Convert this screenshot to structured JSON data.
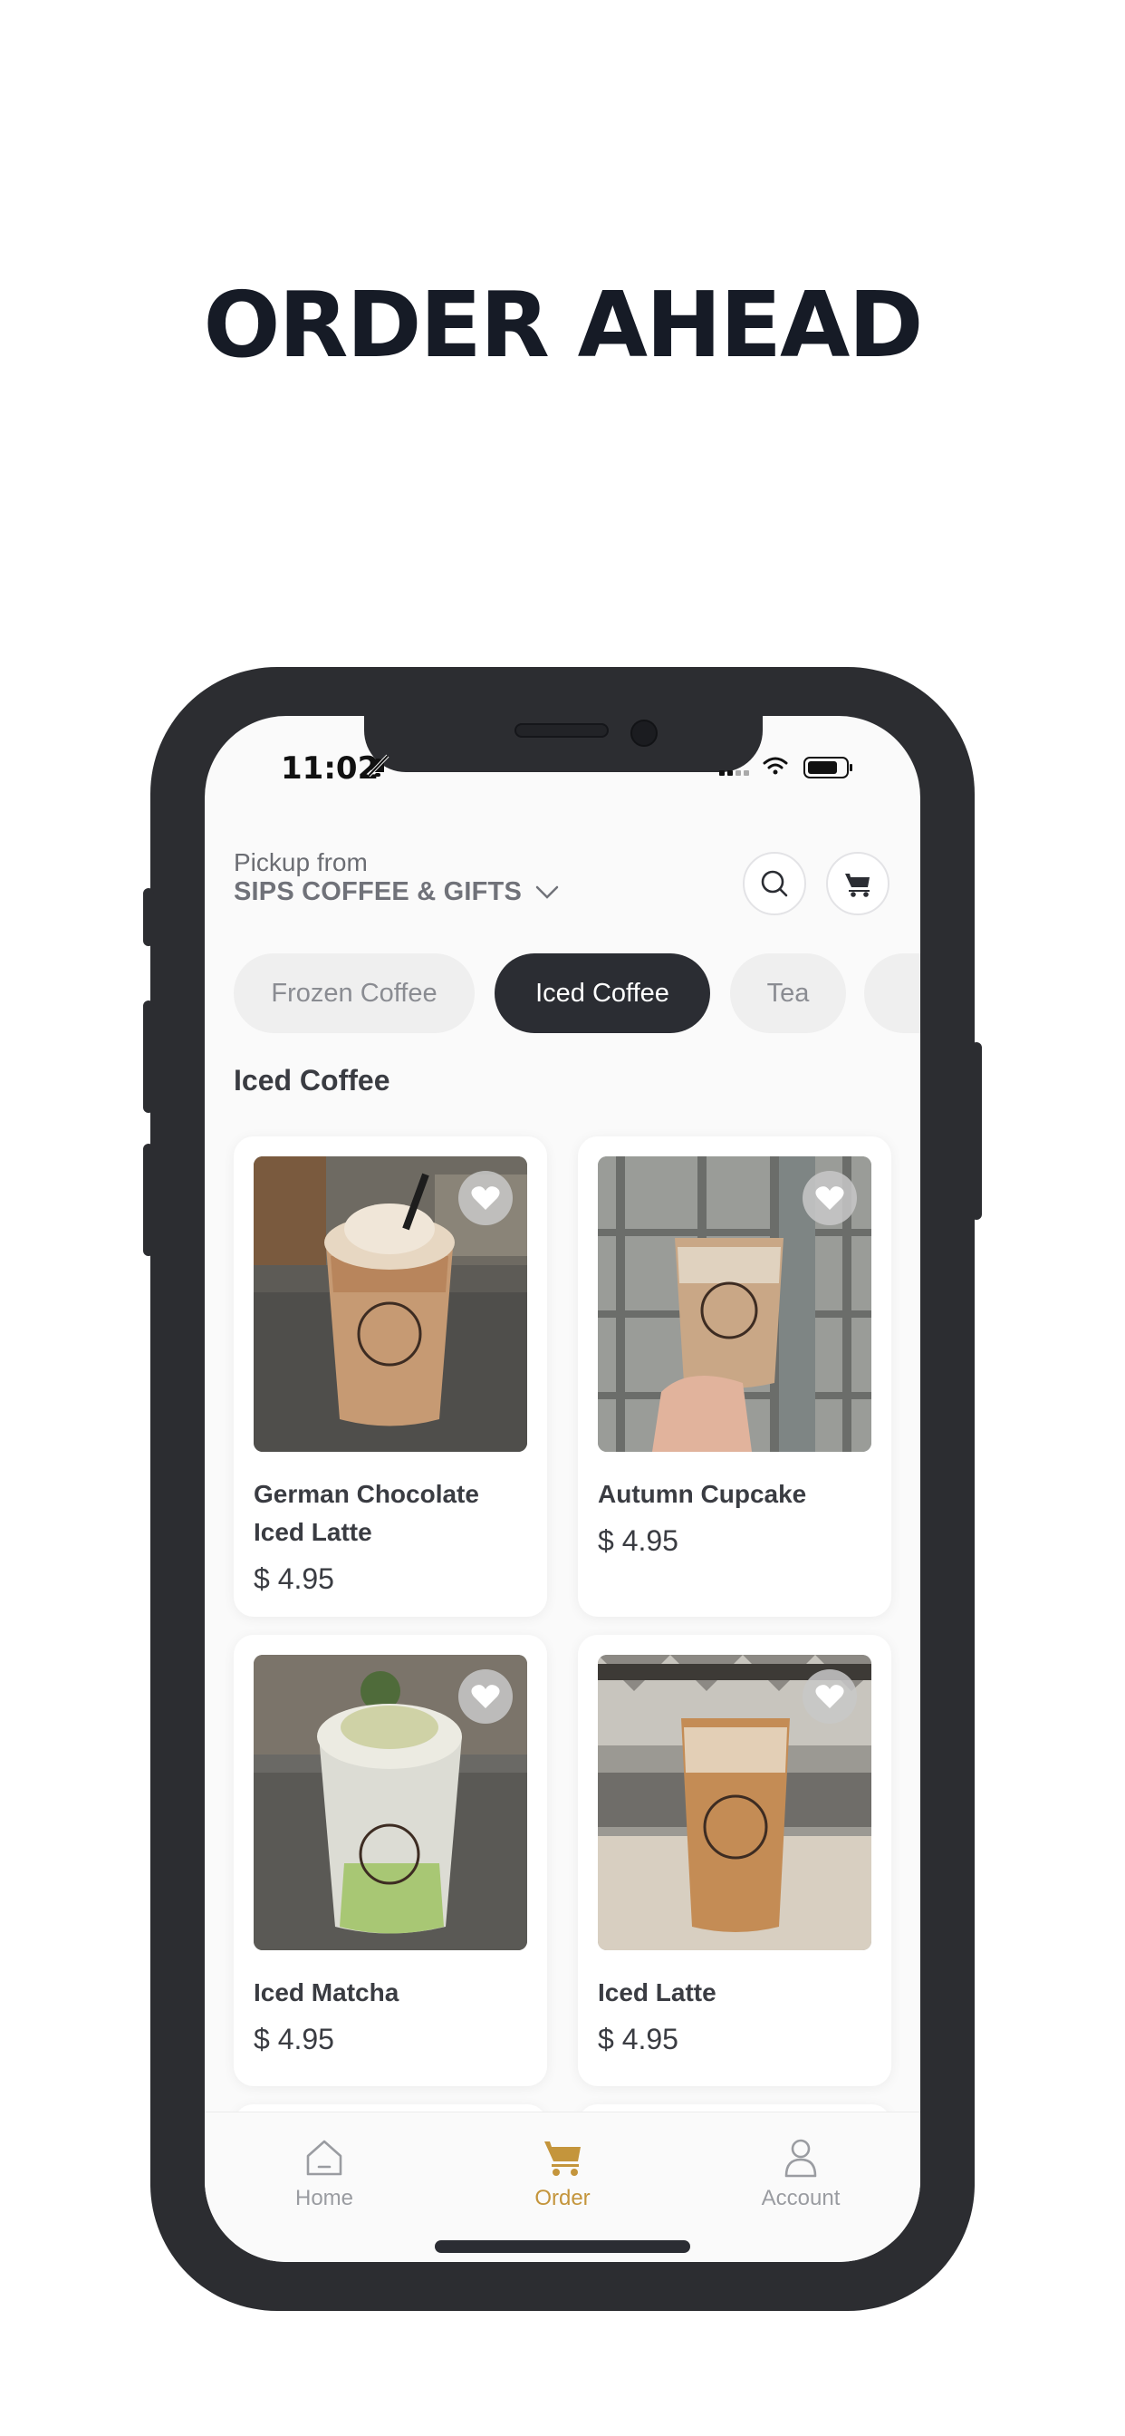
{
  "headline": "ORDER AHEAD",
  "status_bar": {
    "time": "11:02"
  },
  "header": {
    "pickup_label": "Pickup from",
    "store_name": "SIPS COFFEE & GIFTS"
  },
  "categories": [
    {
      "label": "Frozen Coffee",
      "active": false
    },
    {
      "label": "Iced Coffee",
      "active": true
    },
    {
      "label": "Tea",
      "active": false
    }
  ],
  "section_title": "Iced Coffee",
  "products": [
    {
      "name": "German Chocolate Iced Latte",
      "price": "$ 4.95"
    },
    {
      "name": "Autumn Cupcake",
      "price": "$ 4.95"
    },
    {
      "name": "Iced Matcha",
      "price": "$ 4.95"
    },
    {
      "name": "Iced Latte",
      "price": "$ 4.95"
    }
  ],
  "tab_bar": [
    {
      "label": "Home",
      "icon": "home-icon"
    },
    {
      "label": "Order",
      "icon": "cart-icon",
      "active": true
    },
    {
      "label": "Account",
      "icon": "account-icon"
    }
  ],
  "colors": {
    "accent": "#c4953c",
    "dark": "#2b2d33",
    "headline": "#161b26"
  }
}
